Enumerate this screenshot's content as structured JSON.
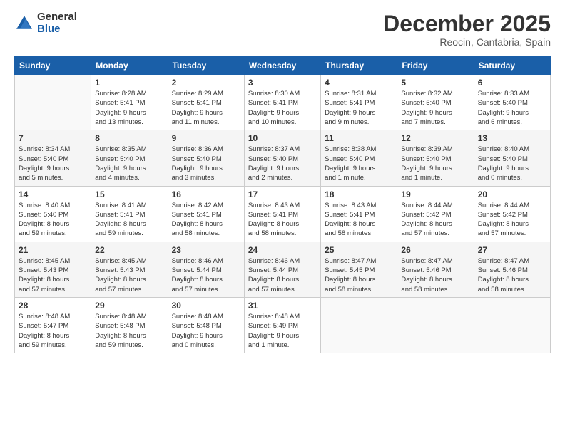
{
  "header": {
    "logo_line1": "General",
    "logo_line2": "Blue",
    "month": "December 2025",
    "location": "Reocin, Cantabria, Spain"
  },
  "weekdays": [
    "Sunday",
    "Monday",
    "Tuesday",
    "Wednesday",
    "Thursday",
    "Friday",
    "Saturday"
  ],
  "weeks": [
    [
      {
        "day": "",
        "info": ""
      },
      {
        "day": "1",
        "info": "Sunrise: 8:28 AM\nSunset: 5:41 PM\nDaylight: 9 hours\nand 13 minutes."
      },
      {
        "day": "2",
        "info": "Sunrise: 8:29 AM\nSunset: 5:41 PM\nDaylight: 9 hours\nand 11 minutes."
      },
      {
        "day": "3",
        "info": "Sunrise: 8:30 AM\nSunset: 5:41 PM\nDaylight: 9 hours\nand 10 minutes."
      },
      {
        "day": "4",
        "info": "Sunrise: 8:31 AM\nSunset: 5:41 PM\nDaylight: 9 hours\nand 9 minutes."
      },
      {
        "day": "5",
        "info": "Sunrise: 8:32 AM\nSunset: 5:40 PM\nDaylight: 9 hours\nand 7 minutes."
      },
      {
        "day": "6",
        "info": "Sunrise: 8:33 AM\nSunset: 5:40 PM\nDaylight: 9 hours\nand 6 minutes."
      }
    ],
    [
      {
        "day": "7",
        "info": "Sunrise: 8:34 AM\nSunset: 5:40 PM\nDaylight: 9 hours\nand 5 minutes."
      },
      {
        "day": "8",
        "info": "Sunrise: 8:35 AM\nSunset: 5:40 PM\nDaylight: 9 hours\nand 4 minutes."
      },
      {
        "day": "9",
        "info": "Sunrise: 8:36 AM\nSunset: 5:40 PM\nDaylight: 9 hours\nand 3 minutes."
      },
      {
        "day": "10",
        "info": "Sunrise: 8:37 AM\nSunset: 5:40 PM\nDaylight: 9 hours\nand 2 minutes."
      },
      {
        "day": "11",
        "info": "Sunrise: 8:38 AM\nSunset: 5:40 PM\nDaylight: 9 hours\nand 1 minute."
      },
      {
        "day": "12",
        "info": "Sunrise: 8:39 AM\nSunset: 5:40 PM\nDaylight: 9 hours\nand 1 minute."
      },
      {
        "day": "13",
        "info": "Sunrise: 8:40 AM\nSunset: 5:40 PM\nDaylight: 9 hours\nand 0 minutes."
      }
    ],
    [
      {
        "day": "14",
        "info": "Sunrise: 8:40 AM\nSunset: 5:40 PM\nDaylight: 8 hours\nand 59 minutes."
      },
      {
        "day": "15",
        "info": "Sunrise: 8:41 AM\nSunset: 5:41 PM\nDaylight: 8 hours\nand 59 minutes."
      },
      {
        "day": "16",
        "info": "Sunrise: 8:42 AM\nSunset: 5:41 PM\nDaylight: 8 hours\nand 58 minutes."
      },
      {
        "day": "17",
        "info": "Sunrise: 8:43 AM\nSunset: 5:41 PM\nDaylight: 8 hours\nand 58 minutes."
      },
      {
        "day": "18",
        "info": "Sunrise: 8:43 AM\nSunset: 5:41 PM\nDaylight: 8 hours\nand 58 minutes."
      },
      {
        "day": "19",
        "info": "Sunrise: 8:44 AM\nSunset: 5:42 PM\nDaylight: 8 hours\nand 57 minutes."
      },
      {
        "day": "20",
        "info": "Sunrise: 8:44 AM\nSunset: 5:42 PM\nDaylight: 8 hours\nand 57 minutes."
      }
    ],
    [
      {
        "day": "21",
        "info": "Sunrise: 8:45 AM\nSunset: 5:43 PM\nDaylight: 8 hours\nand 57 minutes."
      },
      {
        "day": "22",
        "info": "Sunrise: 8:45 AM\nSunset: 5:43 PM\nDaylight: 8 hours\nand 57 minutes."
      },
      {
        "day": "23",
        "info": "Sunrise: 8:46 AM\nSunset: 5:44 PM\nDaylight: 8 hours\nand 57 minutes."
      },
      {
        "day": "24",
        "info": "Sunrise: 8:46 AM\nSunset: 5:44 PM\nDaylight: 8 hours\nand 57 minutes."
      },
      {
        "day": "25",
        "info": "Sunrise: 8:47 AM\nSunset: 5:45 PM\nDaylight: 8 hours\nand 58 minutes."
      },
      {
        "day": "26",
        "info": "Sunrise: 8:47 AM\nSunset: 5:46 PM\nDaylight: 8 hours\nand 58 minutes."
      },
      {
        "day": "27",
        "info": "Sunrise: 8:47 AM\nSunset: 5:46 PM\nDaylight: 8 hours\nand 58 minutes."
      }
    ],
    [
      {
        "day": "28",
        "info": "Sunrise: 8:48 AM\nSunset: 5:47 PM\nDaylight: 8 hours\nand 59 minutes."
      },
      {
        "day": "29",
        "info": "Sunrise: 8:48 AM\nSunset: 5:48 PM\nDaylight: 8 hours\nand 59 minutes."
      },
      {
        "day": "30",
        "info": "Sunrise: 8:48 AM\nSunset: 5:48 PM\nDaylight: 9 hours\nand 0 minutes."
      },
      {
        "day": "31",
        "info": "Sunrise: 8:48 AM\nSunset: 5:49 PM\nDaylight: 9 hours\nand 1 minute."
      },
      {
        "day": "",
        "info": ""
      },
      {
        "day": "",
        "info": ""
      },
      {
        "day": "",
        "info": ""
      }
    ]
  ]
}
